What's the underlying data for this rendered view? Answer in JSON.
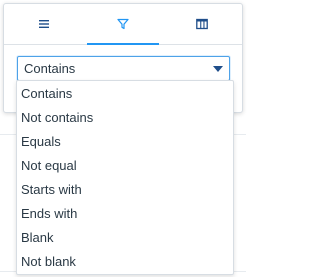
{
  "tabs": [
    {
      "name": "menu-tab",
      "icon": "hamburger-menu-icon",
      "active": false
    },
    {
      "name": "filter-tab",
      "icon": "filter-funnel-icon",
      "active": true
    },
    {
      "name": "columns-tab",
      "icon": "columns-grid-icon",
      "active": false
    }
  ],
  "filter": {
    "selected": "Contains",
    "options": [
      "Contains",
      "Not contains",
      "Equals",
      "Not equal",
      "Starts with",
      "Ends with",
      "Blank",
      "Not blank"
    ]
  },
  "colors": {
    "accent": "#2196f3",
    "text": "#2a3945",
    "icon": "#1f4e8a"
  }
}
